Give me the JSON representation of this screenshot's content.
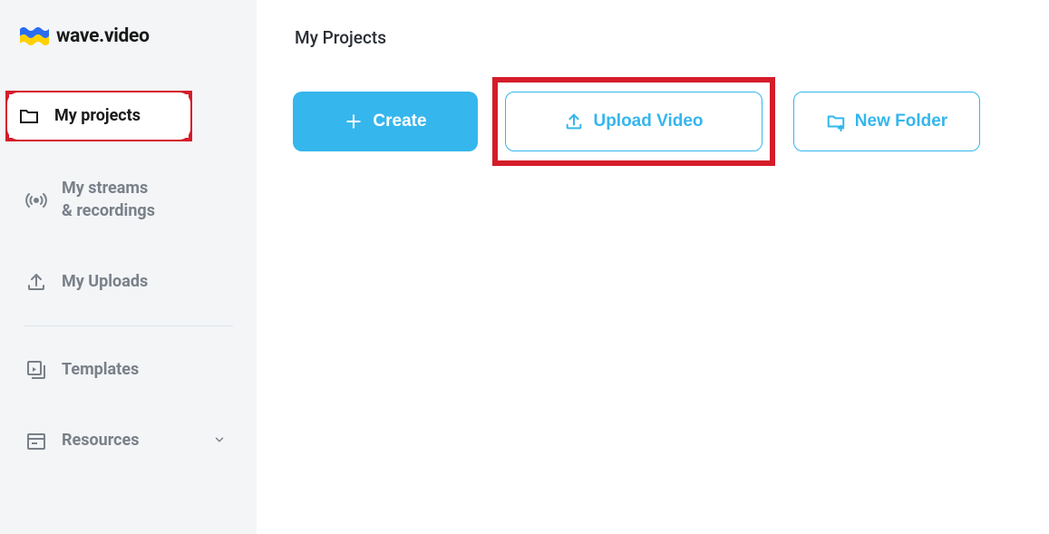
{
  "brand": {
    "name": "wave.video"
  },
  "sidebar": {
    "items": [
      {
        "label": "My projects"
      },
      {
        "label": "My streams\n& recordings"
      },
      {
        "label": "My Uploads"
      },
      {
        "label": "Templates"
      },
      {
        "label": "Resources"
      }
    ]
  },
  "main": {
    "title": "My Projects",
    "buttons": {
      "create": "Create",
      "upload": "Upload Video",
      "newFolder": "New Folder"
    }
  }
}
